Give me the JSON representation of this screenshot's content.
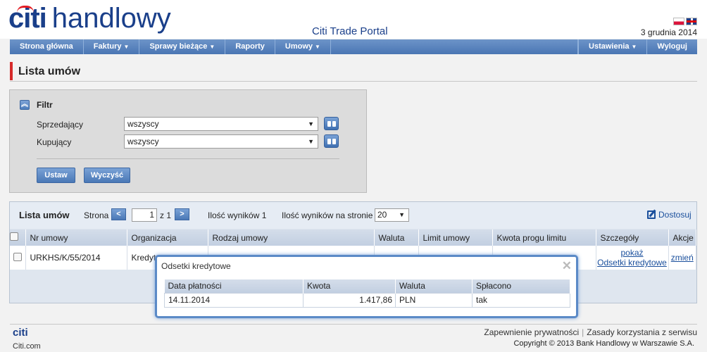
{
  "header": {
    "logo_citi": "citi",
    "logo_bank": "handlowy",
    "portal_title": "Citi Trade Portal",
    "date": "3 grudnia 2014"
  },
  "nav": {
    "items": [
      "Strona główna",
      "Faktury",
      "Sprawy bieżące",
      "Raporty",
      "Umowy"
    ],
    "settings": "Ustawienia",
    "logout": "Wyloguj"
  },
  "page": {
    "title": "Lista umów"
  },
  "filter": {
    "label": "Filtr",
    "seller_label": "Sprzedający",
    "seller_value": "wszyscy",
    "buyer_label": "Kupujący",
    "buyer_value": "wszyscy",
    "apply_label": "Ustaw",
    "clear_label": "Wyczyść"
  },
  "list": {
    "title": "Lista umów",
    "page_label": "Strona",
    "page_value": "1",
    "page_of": "z 1",
    "results": "Ilość wyników 1",
    "per_page_label": "Ilość wyników na stronie",
    "per_page_value": "20",
    "customize": "Dostosuj",
    "columns": [
      "Nr umowy",
      "Organizacja",
      "Rodzaj umowy",
      "Waluta",
      "Limit umowy",
      "Kwota progu limitu",
      "Szczegóły",
      "Akcje"
    ],
    "rows": [
      {
        "nr": "URKHS/K/55/2014",
        "org": "Kredyt",
        "rodzaj": "",
        "waluta": "",
        "limit": "",
        "kwota": "",
        "details_show": "pokaż",
        "details_interest": "Odsetki kredytowe",
        "action": "zmień"
      }
    ]
  },
  "popup": {
    "title": "Odsetki kredytowe",
    "columns": [
      "Data płatności",
      "Kwota",
      "Waluta",
      "Spłacono"
    ],
    "rows": [
      {
        "date": "14.11.2014",
        "amount": "1.417,86",
        "currency": "PLN",
        "paid": "tak"
      }
    ]
  },
  "footer": {
    "logo": "citi",
    "site": "Citi.com",
    "privacy": "Zapewnienie prywatności",
    "terms": "Zasady korzystania z serwisu",
    "copyright": "Copyright © 2013 Bank Handlowy w Warszawie S.A."
  },
  "colors": {
    "brand": "#1a3f8a",
    "accent_red": "#d62a2a",
    "nav": "#4a76b4"
  }
}
